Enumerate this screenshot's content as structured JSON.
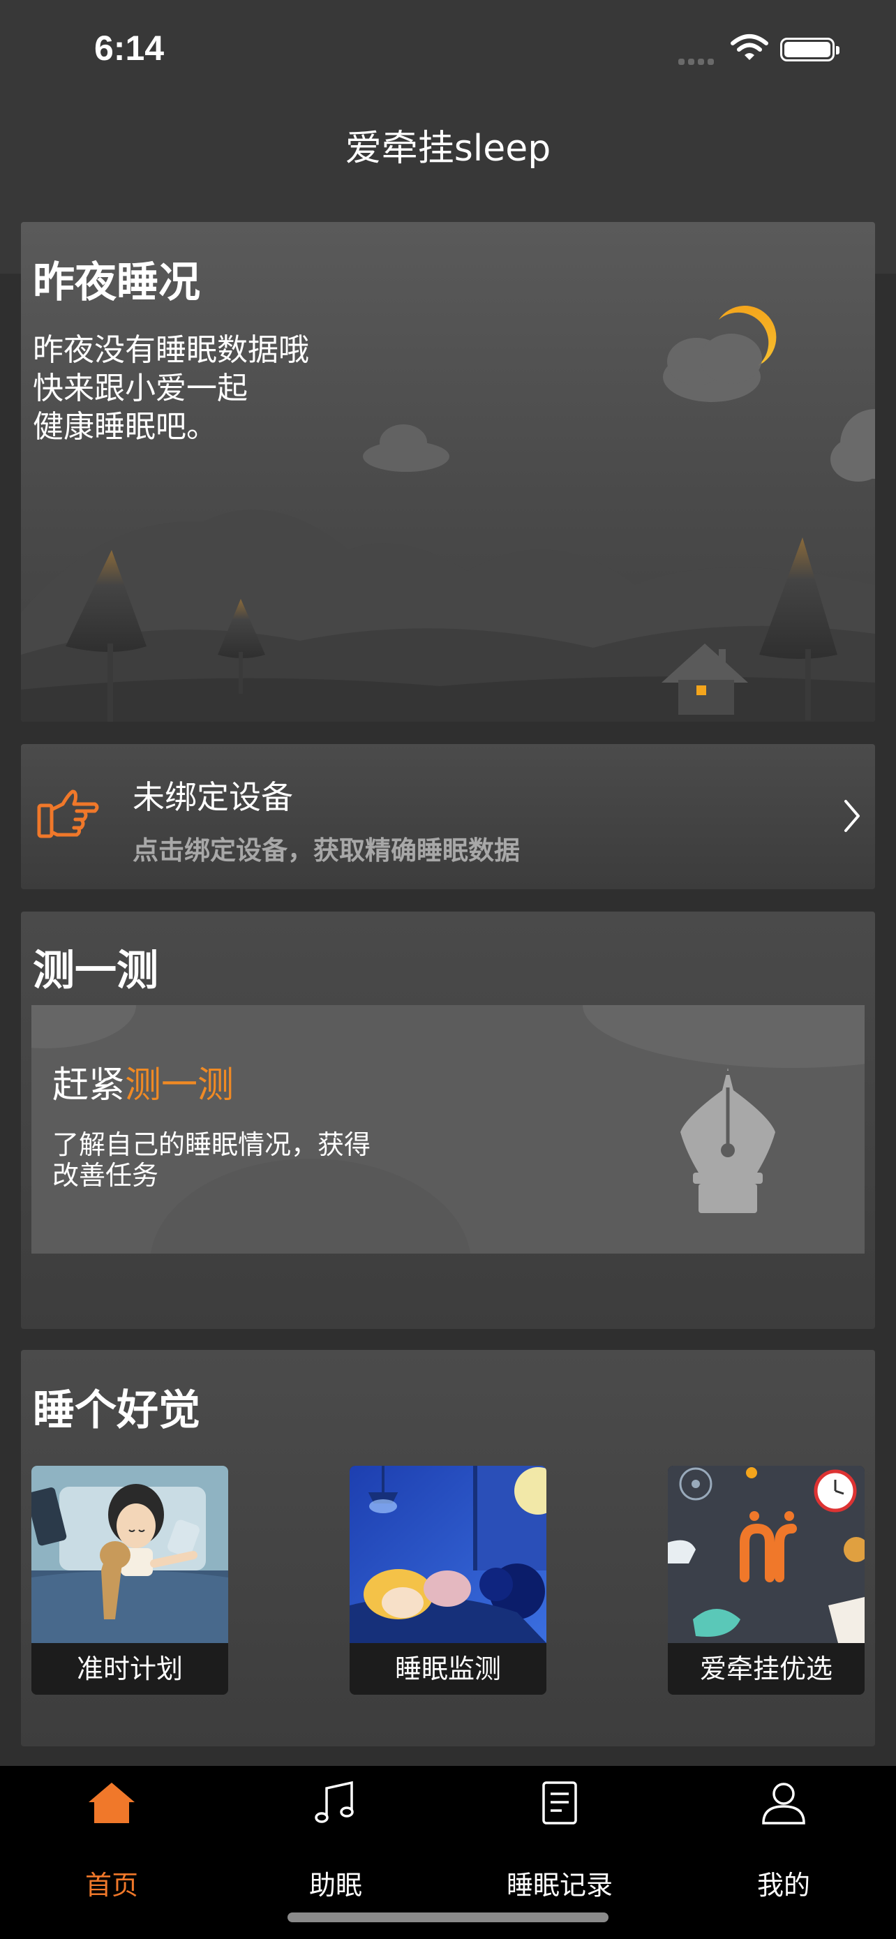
{
  "status_bar": {
    "time": "6:14"
  },
  "header": {
    "title": "爱牵挂sleep"
  },
  "last_night": {
    "title": "昨夜睡况",
    "message_lines": [
      "昨夜没有睡眠数据哦",
      "快来跟小爱一起",
      "健康睡眠吧。"
    ]
  },
  "device": {
    "title": "未绑定设备",
    "subtitle": "点击绑定设备，获取精确睡眠数据",
    "icon": "pointing-hand-icon"
  },
  "test": {
    "title": "测一测",
    "headline_prefix": "赶紧",
    "headline_highlight": "测一测",
    "desc_lines": [
      "了解自己的睡眠情况，获得",
      "改善任务"
    ],
    "icon": "pen-nib-icon"
  },
  "good_sleep": {
    "title": "睡个好觉",
    "tiles": [
      {
        "label": "准时计划"
      },
      {
        "label": "睡眠监测"
      },
      {
        "label": "爱牵挂优选"
      }
    ]
  },
  "tabbar": {
    "tabs": [
      {
        "label": "首页",
        "icon": "home-icon",
        "active": true
      },
      {
        "label": "助眠",
        "icon": "music-note-icon",
        "active": false
      },
      {
        "label": "睡眠记录",
        "icon": "document-icon",
        "active": false
      },
      {
        "label": "我的",
        "icon": "user-icon",
        "active": false
      }
    ]
  },
  "colors": {
    "accent": "#f08a24",
    "tab_active": "#f0782a",
    "background": "#2f2f2f"
  }
}
